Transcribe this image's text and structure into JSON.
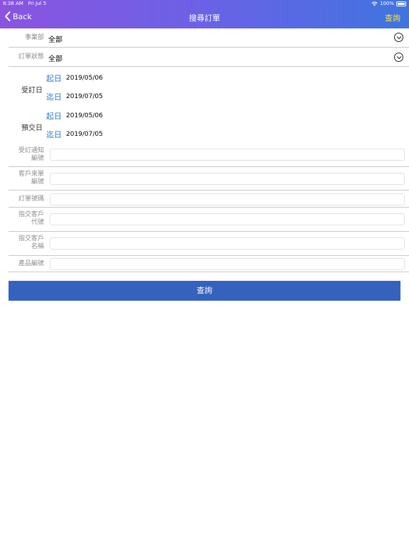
{
  "statusbar": {
    "time": "8:38 AM",
    "date": "Fri Jul 5",
    "battery": "100%"
  },
  "nav": {
    "back_label": "Back",
    "title": "搜尋訂單",
    "action_label": "查詢"
  },
  "filters": {
    "division": {
      "label": "事業部",
      "value": "全部"
    },
    "order_status": {
      "label": "訂單狀態",
      "value": "全部"
    }
  },
  "dates": {
    "order_date": {
      "label": "受訂日",
      "from_tag": "起日",
      "from_value": "2019/05/06",
      "to_tag": "迄日",
      "to_value": "2019/07/05"
    },
    "delivery_date": {
      "label": "預交日",
      "from_tag": "起日",
      "from_value": "2019/05/06",
      "to_tag": "迄日",
      "to_value": "2019/07/05"
    }
  },
  "fields": {
    "order_notice_no": {
      "label_line1": "受訂通知",
      "label_line2": "編號",
      "value": ""
    },
    "customer_order_no": {
      "label_line1": "客戶來單",
      "label_line2": "編號",
      "value": ""
    },
    "order_no": {
      "label_line1": "訂單號碼",
      "value": ""
    },
    "delivery_customer_code": {
      "label_line1": "指交客戶",
      "label_line2": "代號",
      "value": ""
    },
    "delivery_customer_name": {
      "label_line1": "指交客戶",
      "label_line2": "名稱",
      "value": ""
    },
    "product_no": {
      "label_line1": "產品編號",
      "value": ""
    }
  },
  "submit_label": "查詢",
  "colors": {
    "header_start": "#8a54e0",
    "header_end": "#3f74e0",
    "action_yellow": "#f6e53c",
    "date_tag_blue": "#2c79d6",
    "button_blue": "#3562be"
  }
}
